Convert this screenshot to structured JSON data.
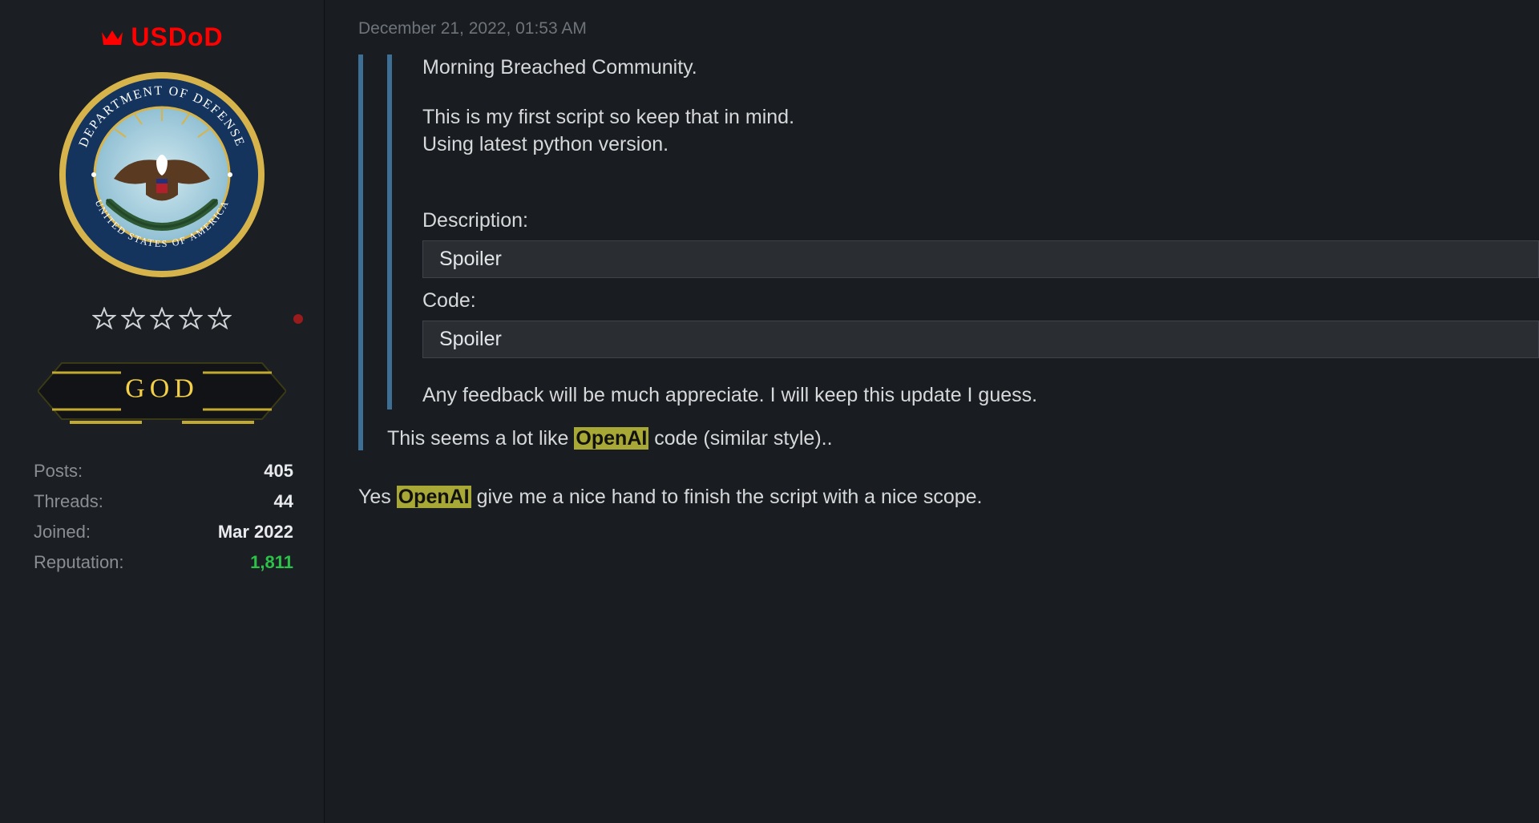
{
  "user": {
    "name": "USDoD",
    "rank_label": "GOD",
    "seal": {
      "top_text": "DEPARTMENT OF DEFENSE",
      "bottom_text": "UNITED STATES OF AMERICA"
    },
    "stats": [
      {
        "label": "Posts:",
        "value": "405"
      },
      {
        "label": "Threads:",
        "value": "44"
      },
      {
        "label": "Joined:",
        "value": "Mar 2022"
      },
      {
        "label": "Reputation:",
        "value": "1,811",
        "highlight_green": true
      }
    ]
  },
  "post": {
    "timestamp": "December 21, 2022, 01:53 AM",
    "quote": {
      "greeting": "Morning Breached Community.",
      "line2": "This is my first script so keep that in mind.",
      "line3": "Using latest python version.",
      "section_desc_label": "Description:",
      "spoiler_desc_label": "Spoiler",
      "section_code_label": "Code:",
      "spoiler_code_label": "Spoiler",
      "closing": "Any feedback will be much appreciate. I will keep this update I guess."
    },
    "reply_outer_pre": "This seems a lot like ",
    "reply_outer_mark": "OpenAI",
    "reply_outer_post": " code (similar style)..",
    "reply_author_pre": "Yes ",
    "reply_author_mark": "OpenAI",
    "reply_author_post": " give me a nice hand to finish the script with a nice scope."
  }
}
